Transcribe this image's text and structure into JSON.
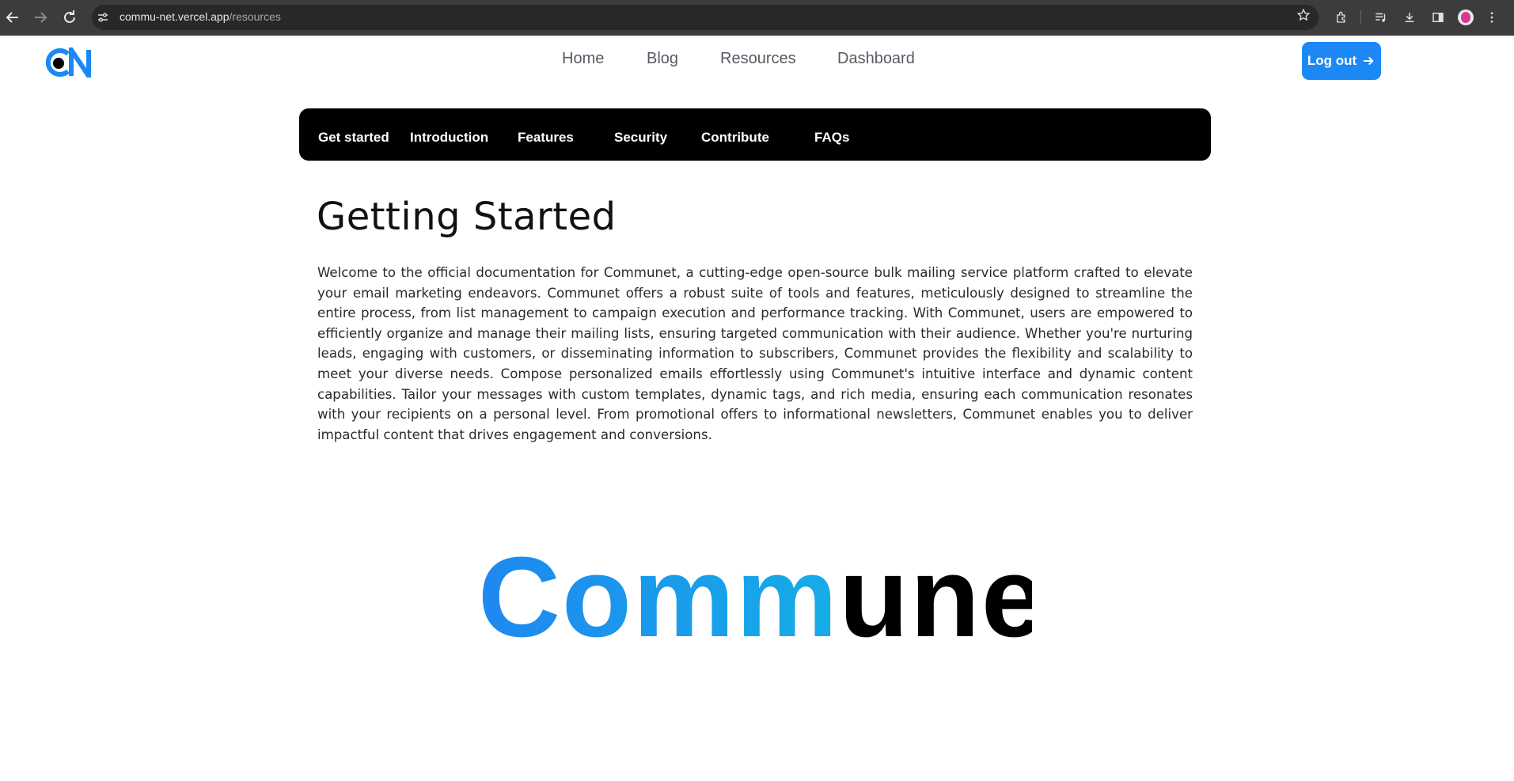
{
  "browser": {
    "url_host": "commu-net.vercel.app",
    "url_path": "/resources",
    "icons": [
      "back-arrow-icon",
      "forward-arrow-icon",
      "reload-icon",
      "site-settings-icon",
      "star-icon",
      "extensions-icon",
      "media-controls-icon",
      "download-icon",
      "side-panel-icon",
      "profile-avatar",
      "kebab-menu-icon"
    ]
  },
  "header": {
    "logo_text": "CN",
    "nav": [
      {
        "label": "Home"
      },
      {
        "label": "Blog"
      },
      {
        "label": "Resources"
      },
      {
        "label": "Dashboard"
      }
    ],
    "logout_label": "Log out"
  },
  "doc_tabs": [
    {
      "label": "Get started"
    },
    {
      "label": "Introduction"
    },
    {
      "label": "Features"
    },
    {
      "label": "Security"
    },
    {
      "label": "Contribute"
    },
    {
      "label": "FAQs"
    }
  ],
  "content": {
    "title": "Getting Started",
    "intro": "Welcome to the official documentation for Communet, a cutting-edge open-source bulk mailing service platform crafted to elevate your email marketing endeavors. Communet offers a robust suite of tools and features, meticulously designed to streamline the entire process, from list management to campaign execution and performance tracking. With Communet, users are empowered to efficiently organize and manage their mailing lists, ensuring targeted communication with their audience. Whether you're nurturing leads, engaging with customers, or disseminating information to subscribers, Communet provides the flexibility and scalability to meet your diverse needs. Compose personalized emails effortlessly using Communet's intuitive interface and dynamic content capabilities. Tailor your messages with custom templates, dynamic tags, and rich media, ensuring each communication resonates with your recipients on a personal level. From promotional offers to informational newsletters, Communet enables you to deliver impactful content that drives engagement and conversions."
  },
  "brand": {
    "gradient_part": "Comm",
    "dark_part": "unet"
  },
  "colors": {
    "chrome_bg": "#3c3c3c",
    "accent_blue": "#1b88f5",
    "gradient_start": "#1e88f0",
    "gradient_end": "#10c6e0",
    "tab_bar_bg": "#000000"
  }
}
